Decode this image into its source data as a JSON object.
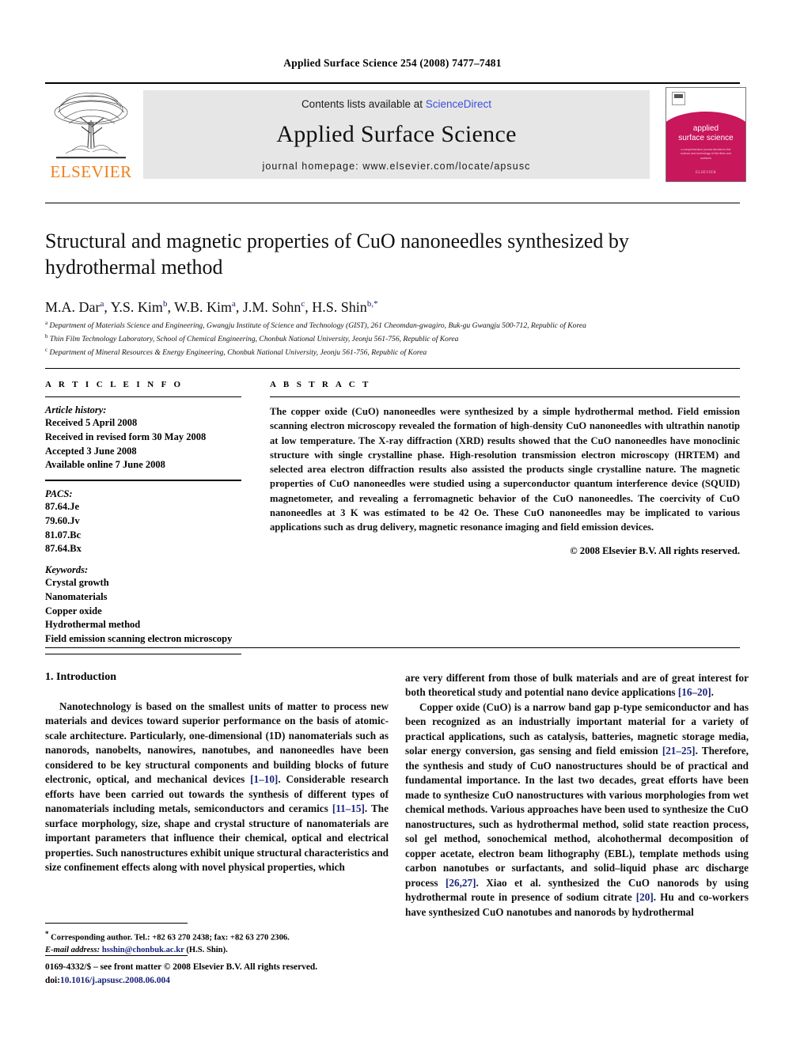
{
  "running_head": "Applied Surface Science 254 (2008) 7477–7481",
  "masthead": {
    "publisher_name": "ELSEVIER",
    "contents_prefix": "Contents lists available at ",
    "sciencedirect_link": "ScienceDirect",
    "journal_title": "Applied Surface Science",
    "homepage": "journal homepage: www.elsevier.com/locate/apsusc",
    "cover": {
      "title_line1": "applied",
      "title_line2": "surface science",
      "subtitle": "a comprehensive journal devoted to the science and technology of thin films and surfaces",
      "footer": "ELSEVIER"
    }
  },
  "article": {
    "title": "Structural and magnetic properties of CuO nanoneedles synthesized by hydrothermal method",
    "authors": [
      {
        "name": "M.A. Dar",
        "sup": "a"
      },
      {
        "name": "Y.S. Kim",
        "sup": "b"
      },
      {
        "name": "W.B. Kim",
        "sup": "a"
      },
      {
        "name": "J.M. Sohn",
        "sup": "c"
      },
      {
        "name": "H.S. Shin",
        "sup": "b,*"
      }
    ],
    "affiliations": [
      {
        "sup": "a",
        "text": "Department of Materials Science and Engineering, Gwangju Institute of Science and Technology (GIST), 261 Cheomdan-gwagiro, Buk-gu Gwangju 500-712, Republic of Korea"
      },
      {
        "sup": "b",
        "text": "Thin Film Technology Laboratory, School of Chemical Engineering, Chonbuk National University, Jeonju 561-756, Republic of Korea"
      },
      {
        "sup": "c",
        "text": "Department of Mineral Resources & Energy Engineering, Chonbuk National University, Jeonju 561-756, Republic of Korea"
      }
    ]
  },
  "article_info": {
    "heading": "A R T I C L E   I N F O",
    "history_label": "Article history:",
    "history": [
      "Received 5 April 2008",
      "Received in revised form 30 May 2008",
      "Accepted 3 June 2008",
      "Available online 7 June 2008"
    ],
    "pacs_label": "PACS:",
    "pacs": [
      "87.64.Je",
      "79.60.Jv",
      "81.07.Bc",
      "87.64.Bx"
    ],
    "keywords_label": "Keywords:",
    "keywords": [
      "Crystal growth",
      "Nanomaterials",
      "Copper oxide",
      "Hydrothermal method",
      "Field emission scanning electron microscopy"
    ]
  },
  "abstract": {
    "heading": "A B S T R A C T",
    "text": "The copper oxide (CuO) nanoneedles were synthesized by a simple hydrothermal method. Field emission scanning electron microscopy revealed the formation of high-density CuO nanoneedles with ultrathin nanotip at low temperature. The X-ray diffraction (XRD) results showed that the CuO nanoneedles have monoclinic structure with single crystalline phase. High-resolution transmission electron microscopy (HRTEM) and selected area electron diffraction results also assisted the products single crystalline nature. The magnetic properties of CuO nanoneedles were studied using a superconductor quantum interference device (SQUID) magnetometer, and revealing a ferromagnetic behavior of the CuO nanoneedles. The coercivity of CuO nanoneedles at 3 K was estimated to be 42 Oe. These CuO nanoneedles may be implicated to various applications such as drug delivery, magnetic resonance imaging and field emission devices.",
    "copyright": "© 2008 Elsevier B.V. All rights reserved."
  },
  "body": {
    "section_title": "1. Introduction",
    "left_col": {
      "p1_a": "Nanotechnology is based on the smallest units of matter to process new materials and devices toward superior performance on the basis of atomic-scale architecture. Particularly, one-dimensional (1D) nanomaterials such as nanorods, nanobelts, nanowires, nanotubes, and nanoneedles have been considered to be key structural components and building blocks of future electronic, optical, and mechanical devices ",
      "ref1": "[1–10]",
      "p1_b": ". Considerable research efforts have been carried out towards the synthesis of different types of nanomaterials including metals, semiconductors and ceramics ",
      "ref2": "[11–15]",
      "p1_c": ". The surface morphology, size, shape and crystal structure of nanomaterials are important parameters that influence their chemical, optical and electrical properties. Such nanostructures exhibit unique structural characteristics and size confinement effects along with novel physical properties, which"
    },
    "right_col": {
      "p1_d": "are very different from those of bulk materials and are of great interest for both theoretical study and potential nano device applications ",
      "ref3": "[16–20]",
      "p1_e": ".",
      "p2_a": "Copper oxide (CuO) is a narrow band gap p-type semiconductor and has been recognized as an industrially important material for a variety of practical applications, such as catalysis, batteries, magnetic storage media, solar energy conversion, gas sensing and field emission ",
      "ref4": "[21–25]",
      "p2_b": ". Therefore, the synthesis and study of CuO nanostructures should be of practical and fundamental importance. In the last two decades, great efforts have been made to synthesize CuO nanostructures with various morphologies from wet chemical methods. Various approaches have been used to synthesize the CuO nanostructures, such as hydrothermal method, solid state reaction process, sol gel method, sonochemical method, alcohothermal decomposition of copper acetate, electron beam lithography (EBL), template methods using carbon nanotubes or surfactants, and solid–liquid phase arc discharge process ",
      "ref5": "[26,27]",
      "p2_c": ". Xiao et al. synthesized the CuO nanorods by using hydrothermal route in presence of sodium citrate ",
      "ref6": "[20]",
      "p2_d": ". Hu and co-workers have synthesized CuO nanotubes and nanorods by hydrothermal"
    }
  },
  "footnote": {
    "marker": "*",
    "corresponding": "Corresponding author. Tel.: +82 63 270 2438; fax: +82 63 270 2306.",
    "email_label": "E-mail address:",
    "email": "hsshin@chonbuk.ac.kr",
    "email_owner": "(H.S. Shin)."
  },
  "footer": {
    "issn_line": "0169-4332/$ – see front matter © 2008 Elsevier B.V. All rights reserved.",
    "doi_label": "doi:",
    "doi": "10.1016/j.apsusc.2008.06.004"
  },
  "colors": {
    "elsevier_orange": "#F07F1A",
    "link_blue": "#18237a",
    "sciencedirect_blue": "#3b4fd8",
    "cover_red": "#c8175a",
    "banner_gray": "#e6e6e6"
  }
}
